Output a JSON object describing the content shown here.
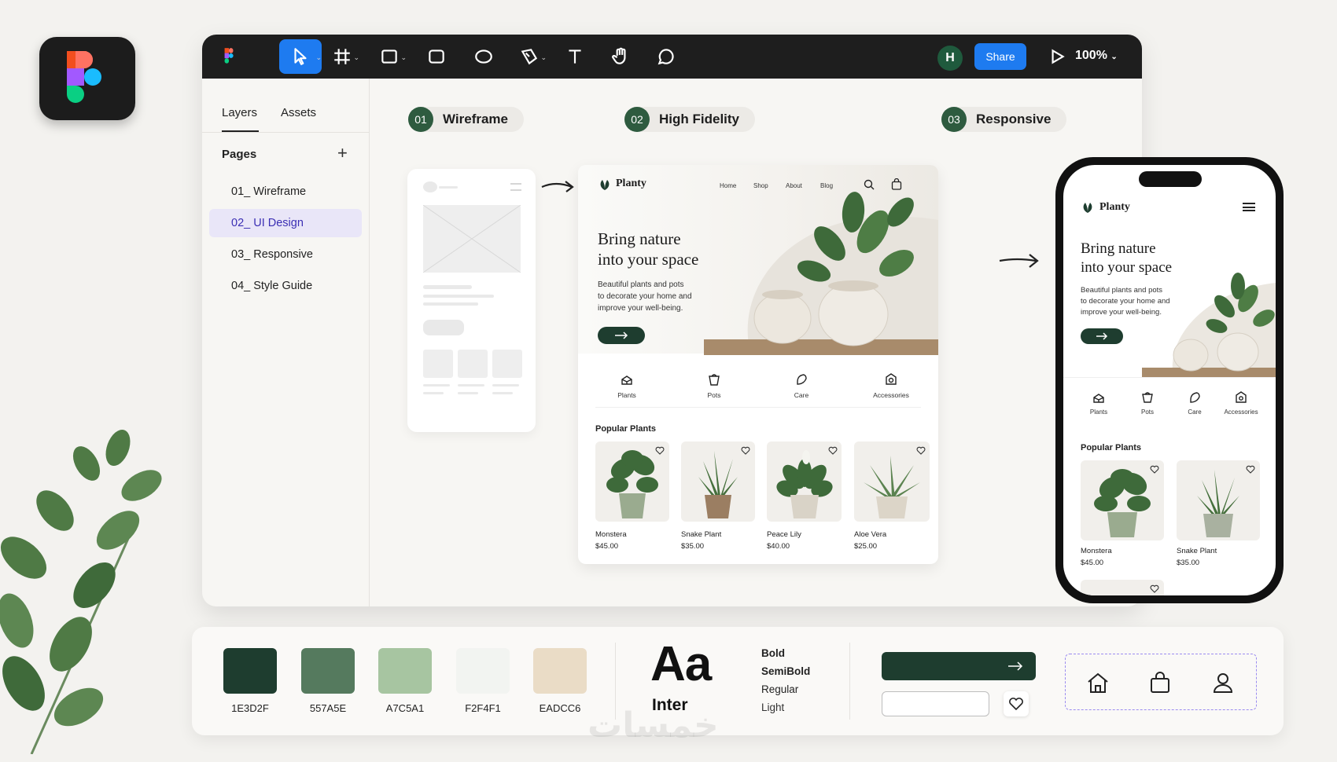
{
  "toolbar": {
    "tools": [
      "move-tool",
      "frame-tool",
      "section-tool",
      "rectangle-tool",
      "ellipse-tool",
      "pen-tool",
      "text-tool",
      "hand-tool",
      "comment-tool"
    ],
    "avatar_initial": "H",
    "share_label": "Share",
    "zoom": "100%"
  },
  "sidebar": {
    "tabs": [
      "Layers",
      "Assets"
    ],
    "pages_label": "Pages",
    "pages": [
      {
        "label": "01_ Wireframe",
        "active": false
      },
      {
        "label": "02_ UI Design",
        "active": true
      },
      {
        "label": "03_ Responsive",
        "active": false
      },
      {
        "label": "04_ Style Guide",
        "active": false
      }
    ]
  },
  "steps": [
    {
      "num": "01",
      "label": "Wireframe"
    },
    {
      "num": "02",
      "label": "High Fidelity"
    },
    {
      "num": "03",
      "label": "Responsive"
    }
  ],
  "site": {
    "brand": "Planty",
    "nav": [
      "Home",
      "Shop",
      "About",
      "Blog"
    ],
    "hero_title_1": "Bring nature",
    "hero_title_2": "into your space",
    "hero_text_1": "Beautiful plants and pots",
    "hero_text_2": "to decorate your home and",
    "hero_text_3": "improve your well-being.",
    "categories": [
      "Plants",
      "Pots",
      "Care",
      "Accessories"
    ],
    "popular_title": "Popular Plants",
    "products": [
      {
        "name": "Monstera",
        "price": "$45.00"
      },
      {
        "name": "Snake Plant",
        "price": "$35.00"
      },
      {
        "name": "Peace Lily",
        "price": "$40.00"
      },
      {
        "name": "Aloe Vera",
        "price": "$25.00"
      }
    ]
  },
  "style_guide": {
    "colors": [
      {
        "hex": "#1E3D2F",
        "label": "1E3D2F"
      },
      {
        "hex": "#557A5E",
        "label": "557A5E"
      },
      {
        "hex": "#A7C5A1",
        "label": "A7C5A1"
      },
      {
        "hex": "#F2F4F1",
        "label": "F2F4F1"
      },
      {
        "hex": "#EADCC6",
        "label": "EADCC6"
      }
    ],
    "type_sample": "Aa",
    "font_name": "Inter",
    "weights": [
      "Bold",
      "SemiBold",
      "Regular",
      "Light"
    ],
    "icons": [
      "home-icon",
      "shopping-bag-icon",
      "user-icon"
    ]
  },
  "watermark": "خمسات"
}
